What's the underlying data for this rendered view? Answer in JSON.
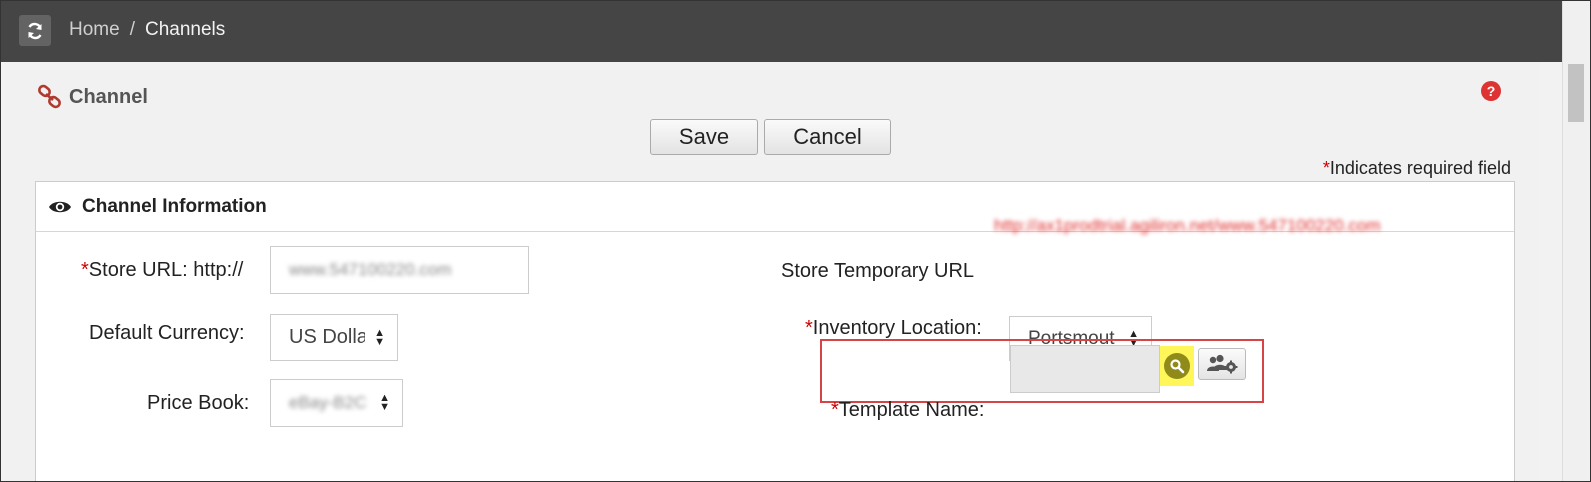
{
  "header": {
    "breadcrumb": {
      "home": "Home",
      "separator": "/",
      "current": "Channels"
    },
    "refresh_icon": "refresh-icon"
  },
  "page": {
    "title": "Channel",
    "title_icon": "link-icon",
    "help_icon": "?"
  },
  "toolbar": {
    "save_label": "Save",
    "cancel_label": "Cancel"
  },
  "required_note": {
    "star": "*",
    "text": "Indicates required field"
  },
  "panel": {
    "title": "Channel Information",
    "icon": "eye-icon",
    "fields": {
      "store_url": {
        "star": "*",
        "label": "Store URL: http://",
        "value": "www.547100220.com"
      },
      "default_currency": {
        "label": "Default Currency:",
        "value": "US Dolla"
      },
      "price_book": {
        "label": "Price Book:",
        "value": "eBay-B2C"
      },
      "store_temp_url": {
        "label": "Store Temporary URL",
        "value": "http://ax1prodtrial.agiliron.net/www.547100220.com"
      },
      "inventory_location": {
        "star": "*",
        "label": "Inventory Location:",
        "value": "Portsmout"
      },
      "template_name": {
        "star": "*",
        "label": "Template Name:",
        "value": ""
      }
    }
  },
  "colors": {
    "topbar": "#454545",
    "required": "#cc0000",
    "highlight_box": "#d64545",
    "search_highlight": "#fff65a"
  }
}
